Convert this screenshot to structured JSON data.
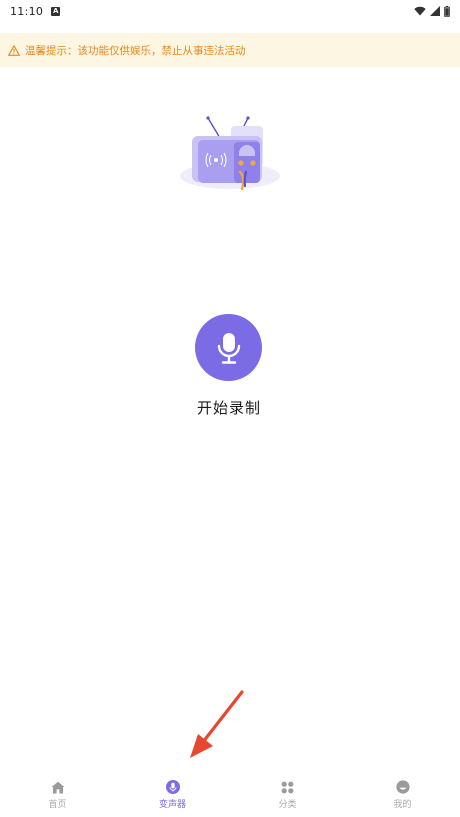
{
  "status_bar": {
    "time": "11:10",
    "notification_icon": "a-icon",
    "right_icons": [
      "wifi-icon",
      "signal-icon",
      "battery-icon"
    ]
  },
  "notice": {
    "icon": "warning-icon",
    "text": "温馨提示：该功能仅供娱乐，禁止从事违法活动",
    "color": "#e8891a",
    "background": "#fdf6e3"
  },
  "illustration": {
    "icon": "radio-illustration"
  },
  "record": {
    "icon": "microphone-icon",
    "label": "开始录制",
    "accent": "#7b6ce6"
  },
  "bottom_nav": {
    "items": [
      {
        "label": "首页",
        "icon": "home-icon",
        "active": false
      },
      {
        "label": "变声器",
        "icon": "voice-changer-icon",
        "active": true
      },
      {
        "label": "分类",
        "icon": "grid-icon",
        "active": false
      },
      {
        "label": "我的",
        "icon": "profile-icon",
        "active": false
      }
    ]
  }
}
